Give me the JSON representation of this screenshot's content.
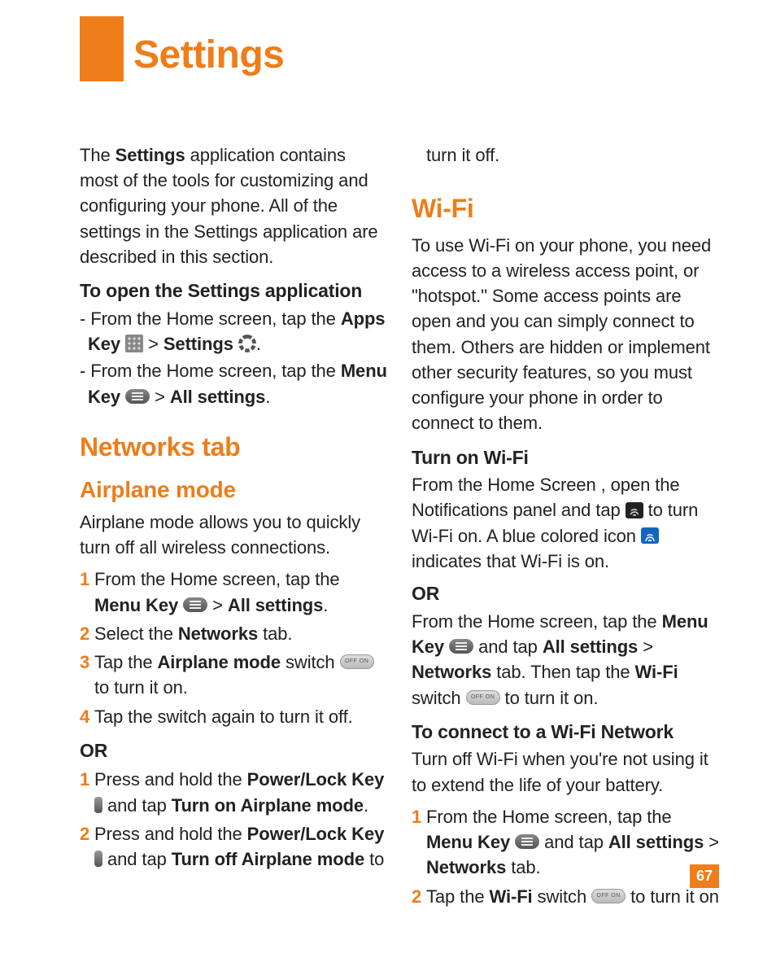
{
  "title": "Settings",
  "page_number": "67",
  "intro": {
    "t1": "The ",
    "b1": "Settings",
    "t2": " application contains most of the tools for customizing and configuring your phone. All of the settings in the Settings application are described in this section."
  },
  "open_heading": "To open the Settings application",
  "open1": {
    "pre": "- From the Home screen, tap the ",
    "b1": "Apps Key",
    "gt": " > ",
    "b2": "Settings",
    "post": "."
  },
  "open2": {
    "pre": "- From the Home screen, tap the ",
    "b1": "Menu Key",
    "gt": " > ",
    "b2": "All settings",
    "post": "."
  },
  "networks_heading": "Networks tab",
  "airplane_heading": "Airplane mode",
  "airplane_intro": "Airplane mode allows you to quickly turn off all wireless connections.",
  "air_steps_a": {
    "s1": {
      "num": "1",
      "t1": "From the Home screen, tap the ",
      "b1": "Menu Key",
      "gt": " > ",
      "b2": "All settings",
      "post": "."
    },
    "s2": {
      "num": "2",
      "t1": "Select the ",
      "b1": "Networks",
      "t2": " tab."
    },
    "s3": {
      "num": "3",
      "t1": "Tap the ",
      "b1": "Airplane mode",
      "t2": " switch ",
      "t3": " to turn it on."
    },
    "s4": {
      "num": "4",
      "t1": "Tap the switch again to turn it off."
    }
  },
  "or_label": "OR",
  "air_steps_b": {
    "s1": {
      "num": "1",
      "t1": "Press and hold the ",
      "b1": "Power/Lock Key",
      "t2": " and tap ",
      "b2": "Turn on Airplane mode",
      "post": "."
    },
    "s2": {
      "num": "2",
      "t1": "Press and hold the ",
      "b1": "Power/Lock Key",
      "t2": " and tap ",
      "b2": "Turn off Airplane mode",
      "post": " to"
    }
  },
  "col2_cont": "turn it off.",
  "wifi_heading": "Wi-Fi",
  "wifi_intro": "To use Wi-Fi on your phone, you need access to a wireless access point, or \"hotspot.\" Some access points are open and you can simply connect to them. Others are hidden or implement other security features, so you must configure your phone in order to connect to them.",
  "turn_on_wifi_head": "Turn on Wi-Fi",
  "turn_on_wifi": {
    "t1": "From the Home Screen , open the Notifications panel and tap ",
    "t2": " to turn Wi-Fi on. A blue colored icon ",
    "t3": " indicates that Wi-Fi is on."
  },
  "wifi_or_para": {
    "t1": "From the Home screen, tap the ",
    "b1": "Menu Key",
    "t2": " and tap ",
    "b2": "All settings",
    "t3": " > ",
    "b3": "Networks",
    "t4": " tab. Then tap the ",
    "b4": "Wi-Fi",
    "t5": " switch ",
    "t6": " to turn it on."
  },
  "connect_head": "To connect to a Wi-Fi Network",
  "connect_intro": "Turn off Wi-Fi when you're not using it to extend the life of your battery.",
  "connect_steps": {
    "s1": {
      "num": "1",
      "t1": "From the Home screen, tap the ",
      "b1": "Menu Key",
      "t2": " and tap ",
      "b2": "All settings",
      "t3": " > ",
      "b3": "Networks",
      "t4": " tab."
    },
    "s2": {
      "num": "2",
      "t1": "Tap the ",
      "b1": "Wi-Fi",
      "t2": " switch ",
      "t3": " to turn it on"
    }
  },
  "switch_label": "OFF  ON"
}
